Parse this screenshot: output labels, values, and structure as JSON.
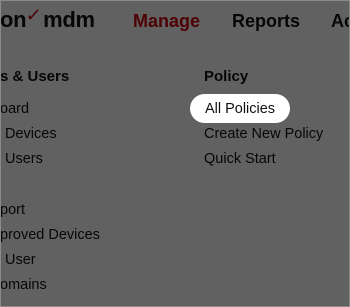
{
  "header": {
    "logo_prefix": "on",
    "logo_check": "✓",
    "logo_suffix": "mdm",
    "nav": [
      {
        "label": "Manage",
        "active": true
      },
      {
        "label": "Reports",
        "active": false
      },
      {
        "label": "Ac",
        "active": false
      }
    ]
  },
  "menu": {
    "left_column": {
      "heading": "s & Users",
      "items": [
        "oard",
        "Devices",
        "Users",
        "port",
        "proved Devices",
        "User",
        "omains"
      ]
    },
    "right_column": {
      "heading": "Policy",
      "items": [
        "All Policies",
        "Create New Policy",
        "Quick Start"
      ],
      "highlighted_index": 0
    }
  },
  "colors": {
    "brand_red": "#cd040b",
    "text": "#111111",
    "overlay": "rgba(0,0,0,0.62)"
  }
}
